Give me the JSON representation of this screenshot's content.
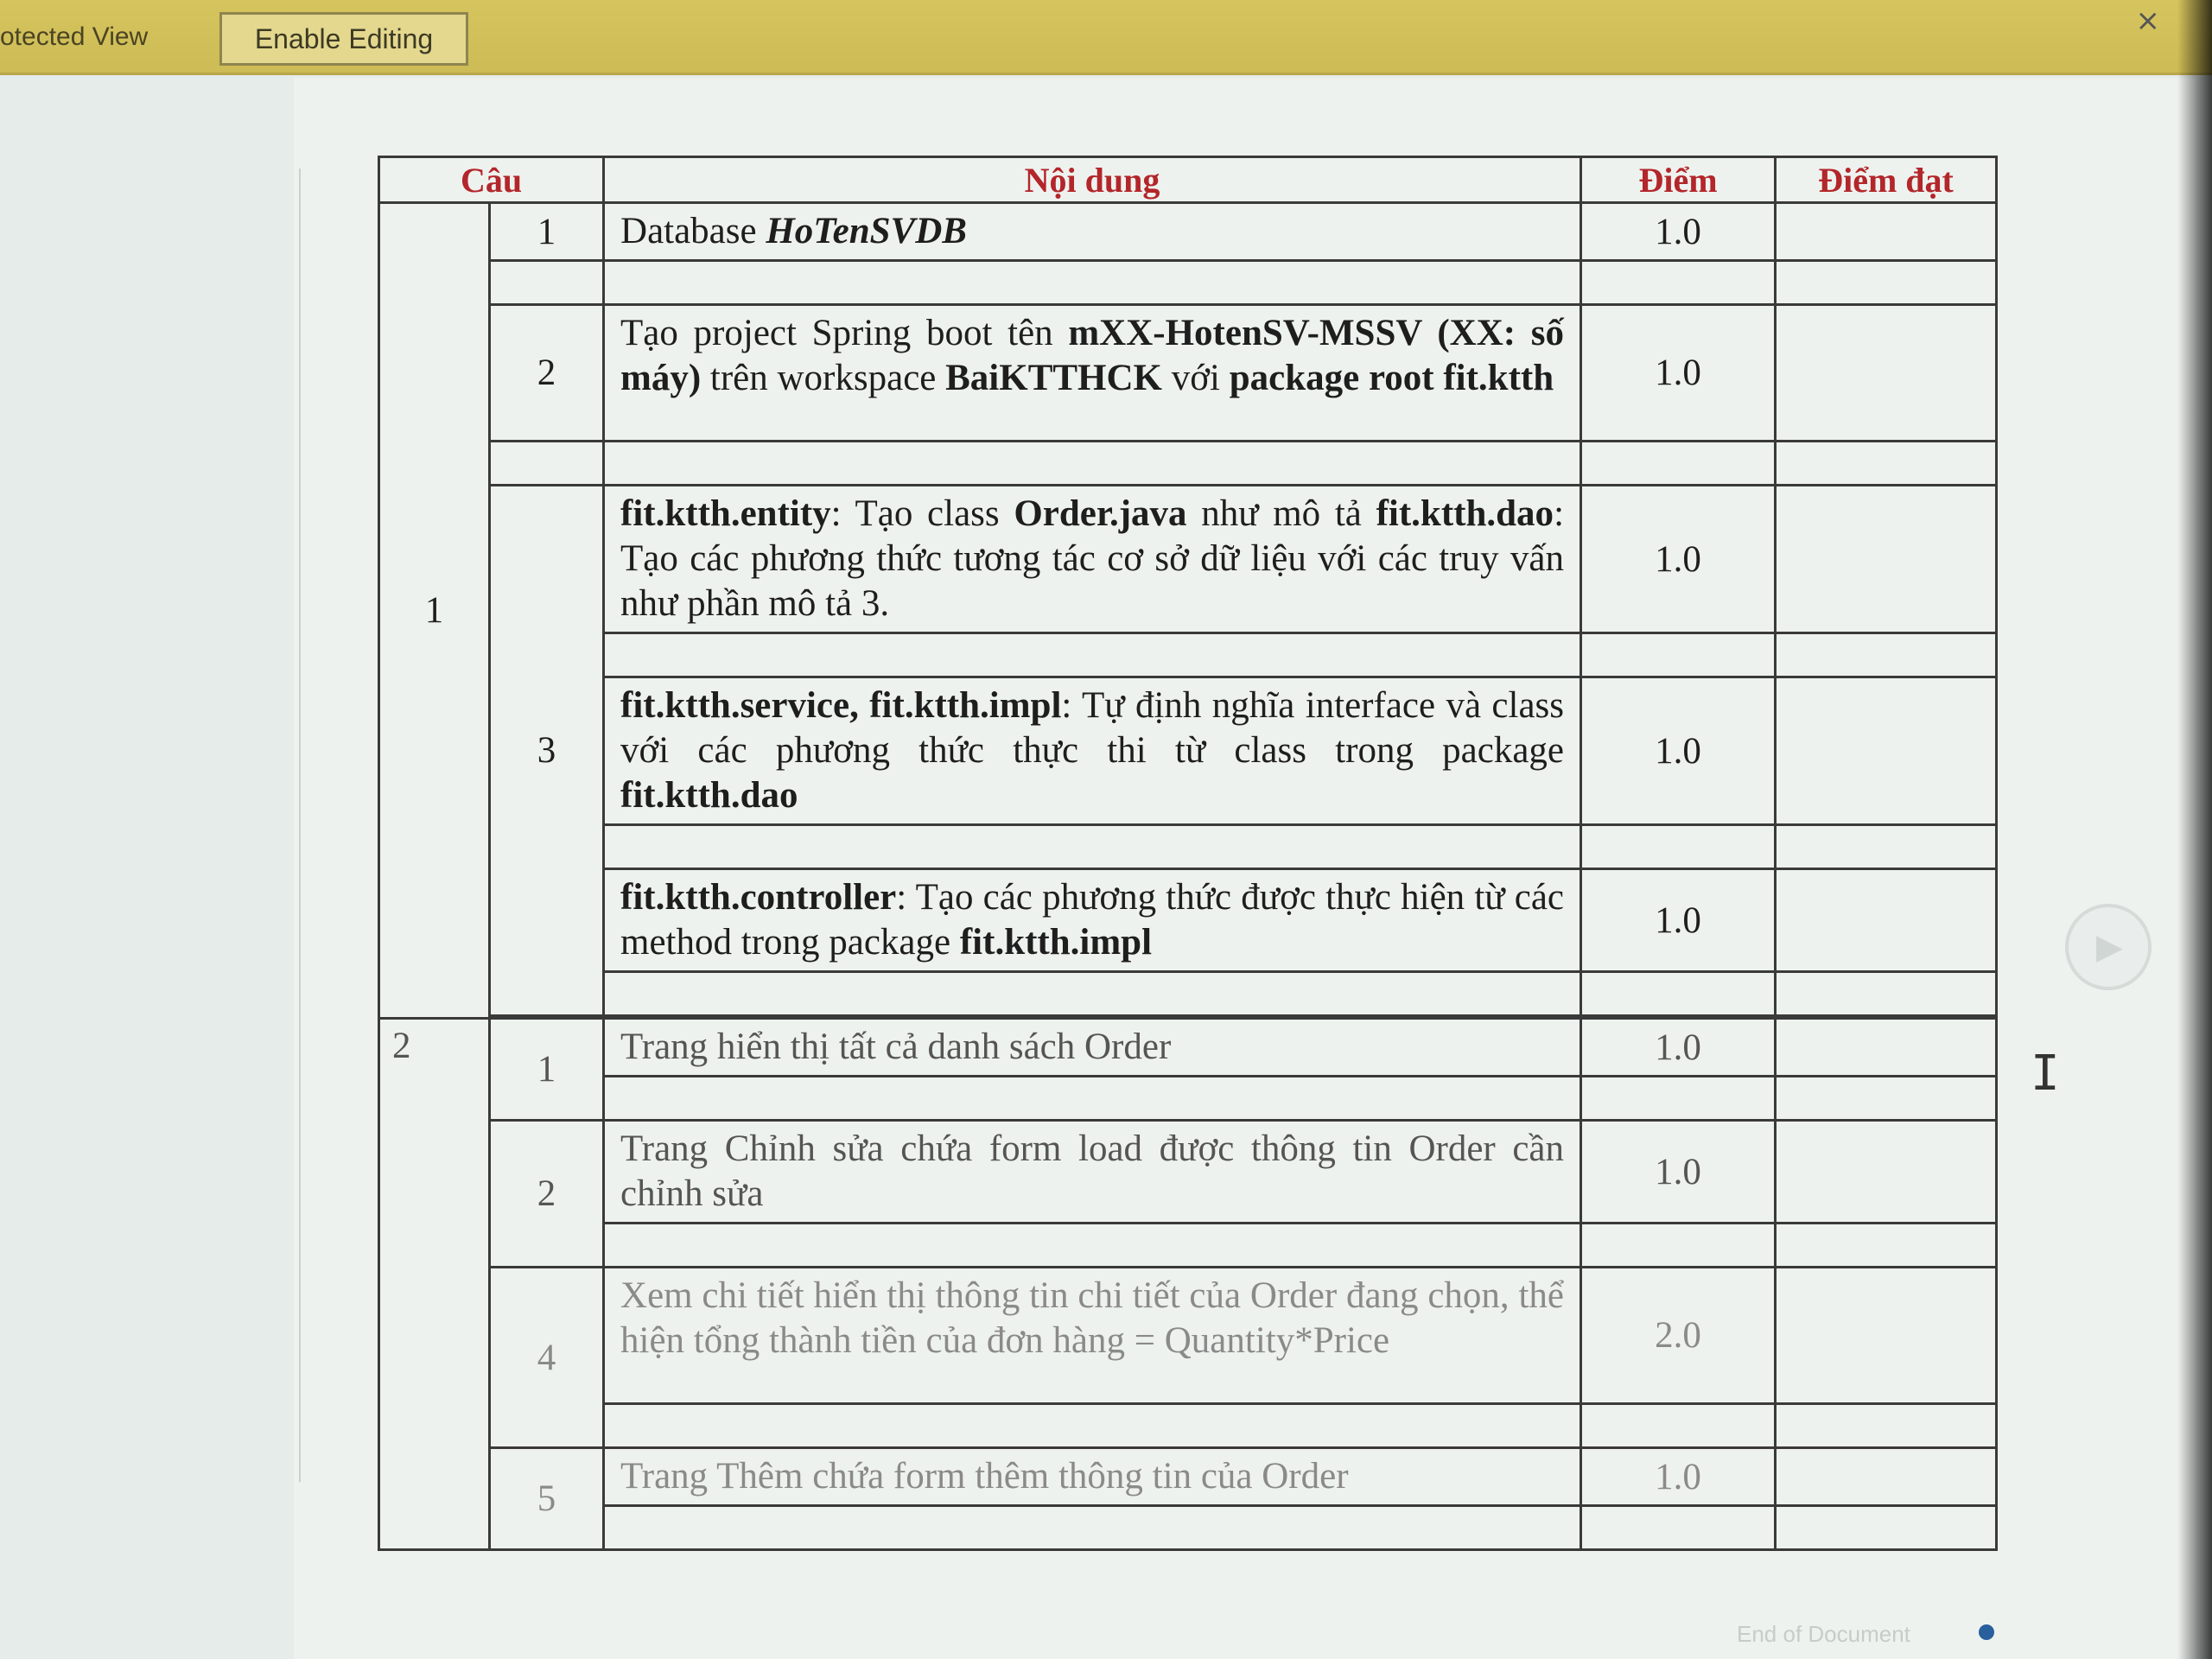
{
  "ribbon": {
    "protected_label": "otected View",
    "enable_editing": "Enable Editing",
    "close": "×"
  },
  "table": {
    "headers": {
      "cau": "Câu",
      "noi_dung": "Nội dung",
      "diem": "Điểm",
      "diem_dat": "Điểm đạt"
    },
    "section1": {
      "number": "1",
      "r1": {
        "sub": "1",
        "text_a": "Database ",
        "text_b": "HoTenSVDB",
        "score": "1.0"
      },
      "r2": {
        "sub": "2",
        "t1": "Tạo project Spring boot tên ",
        "t2": "mXX-HotenSV-MSSV (XX: số máy)",
        "t3": " trên workspace ",
        "t4": "BaiKTTHCK",
        "t5": " với ",
        "t6": "package root fit.ktth",
        "score": "1.0"
      },
      "r3": {
        "sub": "3",
        "a1": "fit.ktth.entity",
        "a2": ": Tạo class ",
        "a3": "Order.java",
        "a4": " như mô tả ",
        "a5": "fit.ktth.dao",
        "a6": ": Tạo các phương thức tương tác cơ sở dữ liệu với các truy vấn như phần mô tả 3.",
        "a_score": "1.0",
        "b1": "fit.ktth.service, fit.ktth.impl",
        "b2": ": Tự định nghĩa interface và class với các phương thức thực thi từ class trong package ",
        "b3": "fit.ktth.dao",
        "b_score": "1.0",
        "c1": "fit.ktth.controller",
        "c2": ": Tạo các phương thức được thực hiện từ các method trong package ",
        "c3": "fit.ktth.impl",
        "c_score": "1.0"
      }
    },
    "section2": {
      "number": "2",
      "r1": {
        "sub": "1",
        "text": "Trang hiển thị tất cả danh sách Order",
        "score": "1.0"
      },
      "r2": {
        "sub": "2",
        "text": "Trang Chỉnh sửa chứa form load được thông tin Order cần chỉnh sửa",
        "score": "1.0"
      },
      "r4": {
        "sub": "4",
        "text": "Xem chi tiết hiển thị thông tin chi tiết của Order đang chọn, thể hiện tổng thành tiền của đơn hàng = Quantity*Price",
        "score": "2.0"
      },
      "r5": {
        "sub": "5",
        "text": "Trang Thêm chứa form thêm thông tin của Order",
        "score": "1.0"
      }
    }
  },
  "scroll_icon": "▶",
  "cursor": "I",
  "status": "End of Document"
}
